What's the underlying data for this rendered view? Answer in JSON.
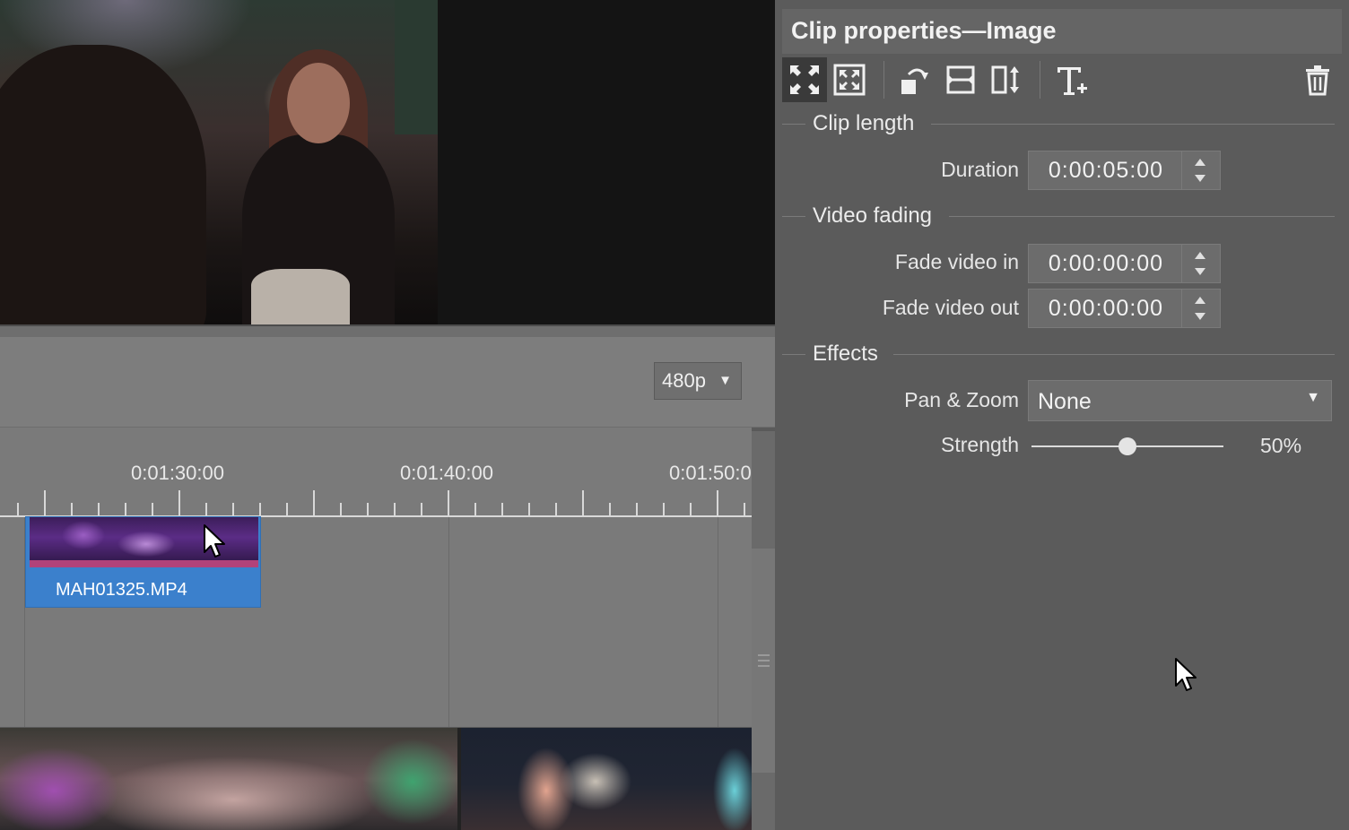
{
  "controls": {
    "resolution": "480p",
    "resolution_arrow": "▼"
  },
  "timeline": {
    "ruler_labels": [
      "0:01:30:00",
      "0:01:40:00",
      "0:01:50:0"
    ],
    "clip": {
      "name": "MAH01325.MP4"
    }
  },
  "panel": {
    "title": "Clip properties—Image",
    "toolbar": {
      "buttons": [
        "fit-fullscreen-icon",
        "fit-frame-icon",
        "rotate-icon",
        "flip-horizontal-icon",
        "flip-vertical-icon",
        "add-text-icon",
        "trash-icon"
      ]
    },
    "sections": {
      "clip_length": "Clip length",
      "video_fading": "Video fading",
      "effects": "Effects"
    },
    "fields": {
      "duration_label": "Duration",
      "duration_value": "0:00:05:00",
      "fade_in_label": "Fade video in",
      "fade_in_value": "0:00:00:00",
      "fade_out_label": "Fade video out",
      "fade_out_value": "0:00:00:00",
      "pan_zoom_label": "Pan & Zoom",
      "pan_zoom_value": "None",
      "pan_zoom_arrow": "▼",
      "strength_label": "Strength",
      "strength_value": "50%",
      "strength_fraction": 0.5
    }
  },
  "colors": {
    "clip_selected": "#3b80cc",
    "panel_bg": "#5b5b5b",
    "timeline_bg": "#7a7a7a"
  }
}
